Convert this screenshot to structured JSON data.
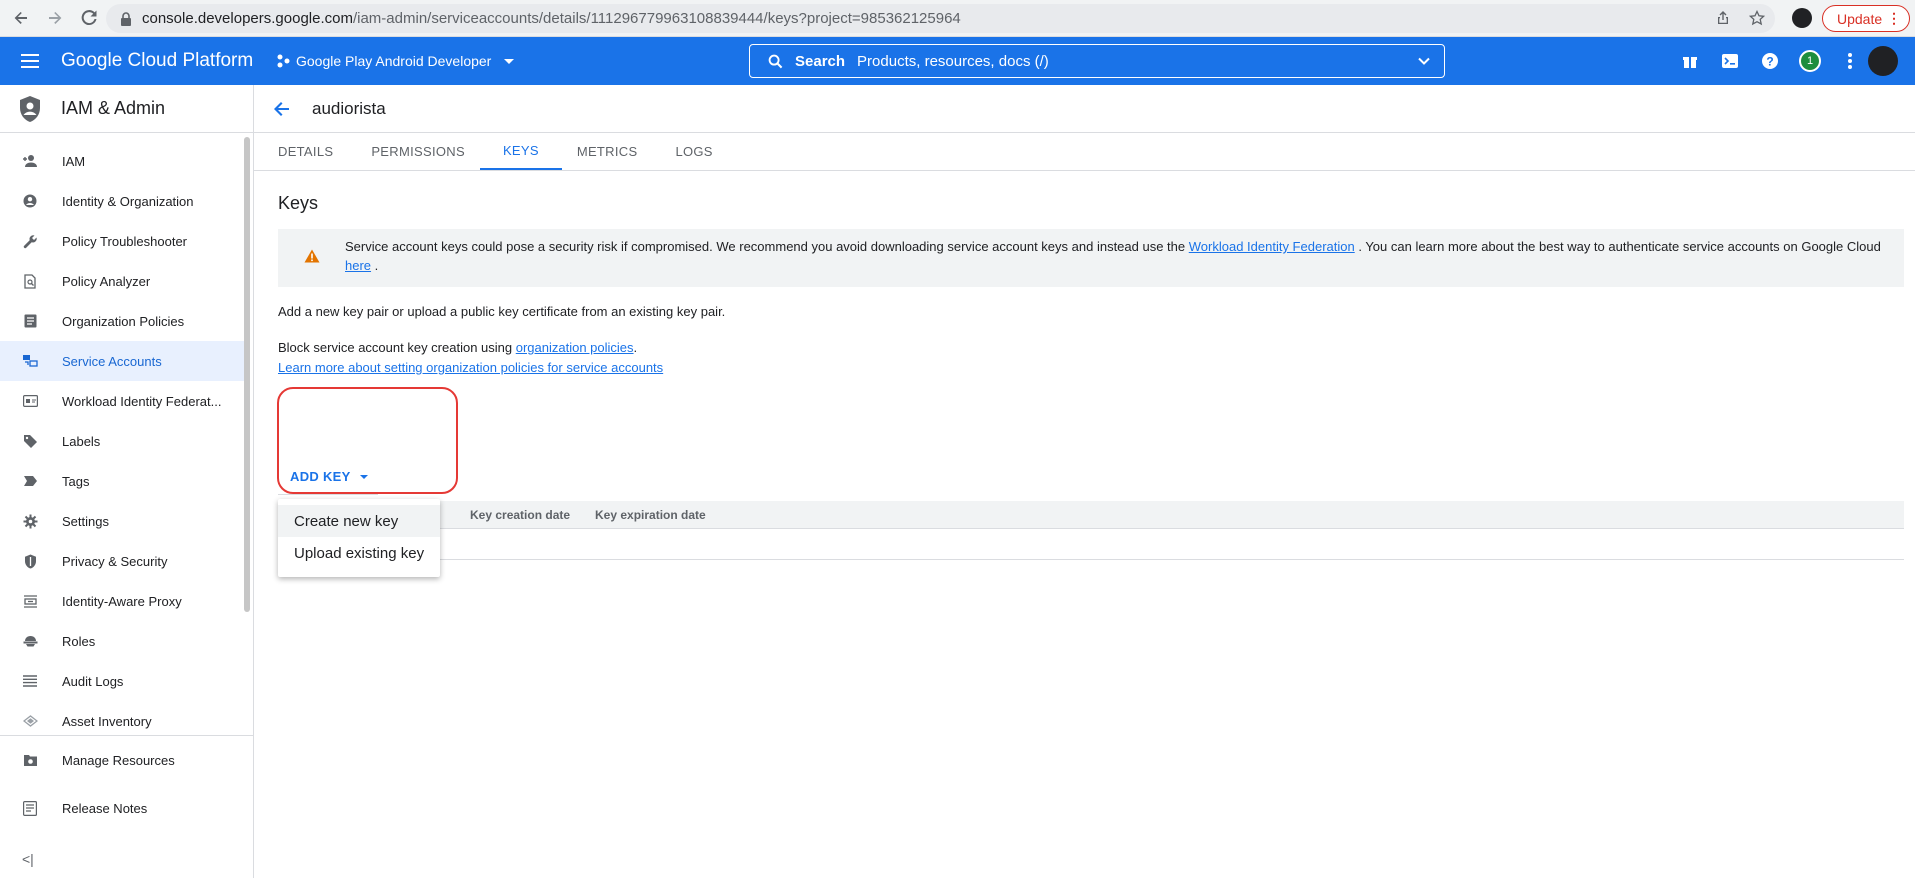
{
  "browser": {
    "url_host": "console.developers.google.com",
    "url_path": "/iam-admin/serviceaccounts/details/111296779963108839444/keys?project=985362125964",
    "update_label": "Update"
  },
  "header": {
    "brand": "Google Cloud Platform",
    "project": "Google Play Android Developer",
    "search_label": "Search",
    "search_placeholder": "Products, resources, docs (/)",
    "notification_count": "1"
  },
  "sidebar": {
    "title": "IAM & Admin",
    "items": [
      {
        "label": "IAM",
        "icon": "person-add-icon"
      },
      {
        "label": "Identity & Organization",
        "icon": "account-circle-icon"
      },
      {
        "label": "Policy Troubleshooter",
        "icon": "wrench-icon"
      },
      {
        "label": "Policy Analyzer",
        "icon": "doc-search-icon"
      },
      {
        "label": "Organization Policies",
        "icon": "list-doc-icon"
      },
      {
        "label": "Service Accounts",
        "icon": "service-account-icon"
      },
      {
        "label": "Workload Identity Federat...",
        "icon": "id-card-icon"
      },
      {
        "label": "Labels",
        "icon": "label-icon"
      },
      {
        "label": "Tags",
        "icon": "tag-icon"
      },
      {
        "label": "Settings",
        "icon": "gear-icon"
      },
      {
        "label": "Privacy & Security",
        "icon": "shield-icon"
      },
      {
        "label": "Identity-Aware Proxy",
        "icon": "proxy-icon"
      },
      {
        "label": "Roles",
        "icon": "roles-icon"
      },
      {
        "label": "Audit Logs",
        "icon": "list-icon"
      },
      {
        "label": "Asset Inventory",
        "icon": "diamond-icon"
      }
    ],
    "footer": [
      {
        "label": "Manage Resources",
        "icon": "settings-box-icon"
      },
      {
        "label": "Release Notes",
        "icon": "notes-icon"
      }
    ],
    "collapse_label": "<|"
  },
  "main": {
    "account_name": "audiorista",
    "tabs": [
      "DETAILS",
      "PERMISSIONS",
      "KEYS",
      "METRICS",
      "LOGS"
    ],
    "section_title": "Keys",
    "warning": {
      "text_before": "Service account keys could pose a security risk if compromised. We recommend you avoid downloading service account keys and instead use the ",
      "link1": "Workload Identity Federation",
      "text_middle": " . You can learn more about the best way to authenticate service accounts on Google Cloud ",
      "link2": "here",
      "text_after": " ."
    },
    "add_info": "Add a new key pair or upload a public key certificate from an existing key pair.",
    "block_text": "Block service account key creation using ",
    "block_link": "organization policies",
    "block_after": ".",
    "learn_link": "Learn more about setting organization policies for service accounts",
    "add_key_label": "ADD KEY",
    "table_columns": [
      "Key creation date",
      "Key expiration date"
    ],
    "menu_items": [
      "Create new key",
      "Upload existing key"
    ]
  }
}
